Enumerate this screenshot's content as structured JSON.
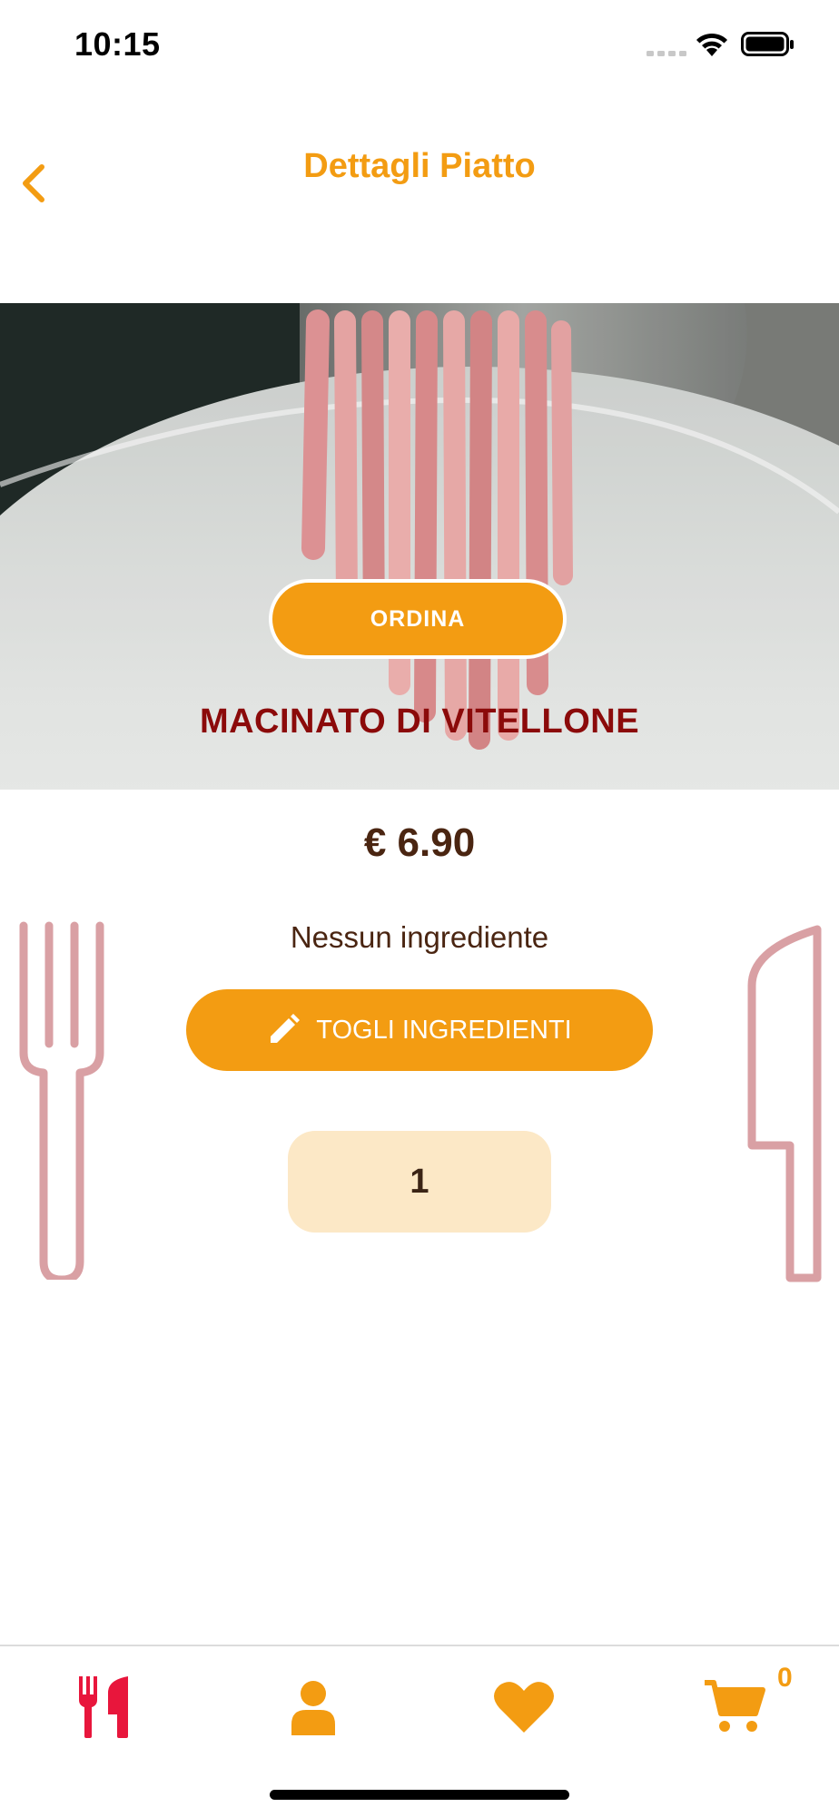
{
  "status_bar": {
    "time": "10:15"
  },
  "header": {
    "title": "Dettagli Piatto",
    "back_icon": "chevron-left-icon"
  },
  "dish": {
    "order_label": "ORDINA",
    "name": "MACINATO DI VITELLONE",
    "price": "€ 6.90"
  },
  "ingredients": {
    "summary": "Nessun ingrediente",
    "remove_button_label": "TOGLI INGREDIENTI",
    "remove_button_icon": "pencil-icon"
  },
  "quantity": {
    "value": "1"
  },
  "tab_bar": {
    "tabs": [
      {
        "icon": "fork-knife-icon",
        "active": true
      },
      {
        "icon": "user-icon",
        "active": false
      },
      {
        "icon": "heart-icon",
        "active": false
      },
      {
        "icon": "cart-icon",
        "active": false
      }
    ],
    "cart_count": "0"
  },
  "colors": {
    "accent": "#f39c12",
    "dish_name": "#8b0a0a",
    "text_brown": "#4a2511",
    "quantity_bg": "#fce8c6",
    "active_tab": "#e8163c",
    "cutlery_decor": "#d9a0a4"
  }
}
